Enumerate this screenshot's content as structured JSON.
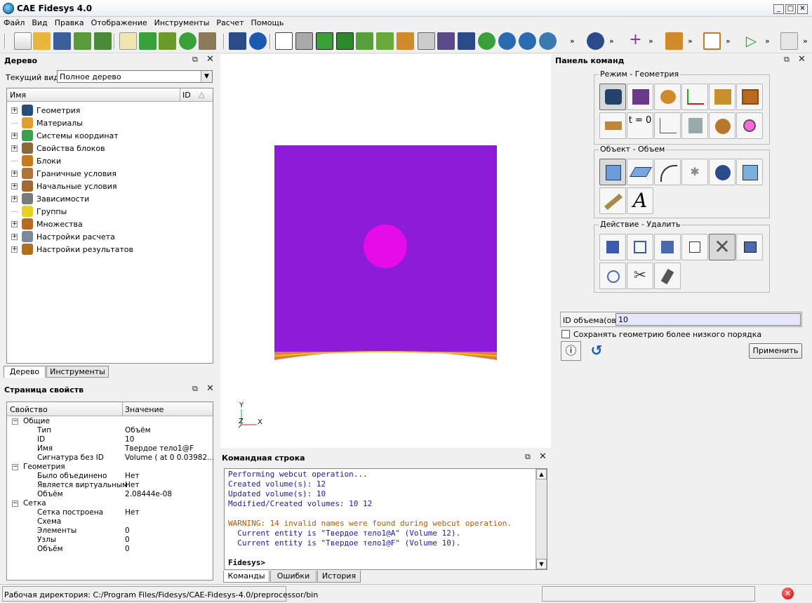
{
  "window": {
    "title": "CAE Fidesys 4.0",
    "minimize": "_",
    "maximize": "□",
    "close": "✕"
  },
  "menu": [
    "Файл",
    "Вид",
    "Правка",
    "Отображение",
    "Инструменты",
    "Расчет",
    "Помощь"
  ],
  "tree_panel": {
    "title": "Дерево",
    "current_view_label": "Текущий вид",
    "current_view_value": "Полное дерево",
    "col_name": "Имя",
    "col_id": "ID",
    "items": [
      {
        "label": "Геометрия",
        "expandable": true,
        "icon": "geometry-icon",
        "color": "#264e7a"
      },
      {
        "label": "Материалы",
        "expandable": false,
        "icon": "materials-icon",
        "color": "#e0a030"
      },
      {
        "label": "Системы координат",
        "expandable": true,
        "icon": "axes-icon",
        "color": "#3aa04a"
      },
      {
        "label": "Свойства блоков",
        "expandable": true,
        "icon": "beam-icon",
        "color": "#8a6a3a"
      },
      {
        "label": "Блоки",
        "expandable": false,
        "icon": "blocks-icon",
        "color": "#c87a1a"
      },
      {
        "label": "Граничные условия",
        "expandable": true,
        "icon": "boundary-icon",
        "color": "#b0743a"
      },
      {
        "label": "Начальные условия",
        "expandable": true,
        "icon": "initial-icon",
        "color": "#a06a30"
      },
      {
        "label": "Зависимости",
        "expandable": true,
        "icon": "graph-icon",
        "color": "#7a7a7a"
      },
      {
        "label": "Группы",
        "expandable": false,
        "icon": "groups-icon",
        "color": "#e8d020"
      },
      {
        "label": "Множества",
        "expandable": true,
        "icon": "sets-icon",
        "color": "#b86a20"
      },
      {
        "label": "Настройки расчета",
        "expandable": true,
        "icon": "calc-icon",
        "color": "#7a8a9a"
      },
      {
        "label": "Настройки результатов",
        "expandable": true,
        "icon": "results-icon",
        "color": "#b07020"
      }
    ],
    "tabs": [
      "Дерево",
      "Инструменты"
    ]
  },
  "props_panel": {
    "title": "Страница свойств",
    "col_prop": "Свойство",
    "col_value": "Значение",
    "rows": [
      {
        "k": "Общие",
        "v": "",
        "level": 0
      },
      {
        "k": "Тип",
        "v": "Объём",
        "level": 1
      },
      {
        "k": "ID",
        "v": "10",
        "level": 1
      },
      {
        "k": "Имя",
        "v": "Твердое тело1@F",
        "level": 1
      },
      {
        "k": "Сигнатура без ID",
        "v": "Volume ( at 0 0.03982...",
        "level": 1
      },
      {
        "k": "Геометрия",
        "v": "",
        "level": 0
      },
      {
        "k": "Было объединено",
        "v": "Нет",
        "level": 1
      },
      {
        "k": "Является виртуальным",
        "v": "Нет",
        "level": 1
      },
      {
        "k": "Объём",
        "v": "2.08444e-08",
        "level": 1
      },
      {
        "k": "Сетка",
        "v": "",
        "level": 0
      },
      {
        "k": "Сетка построена",
        "v": "Нет",
        "level": 1
      },
      {
        "k": "Схема",
        "v": "",
        "level": 1
      },
      {
        "k": "Элементы",
        "v": "0",
        "level": 1
      },
      {
        "k": "Узлы",
        "v": "0",
        "level": 1
      },
      {
        "k": "Объём",
        "v": "0",
        "level": 1
      }
    ]
  },
  "viewport": {
    "axis_y": "Y",
    "axis_z": "Z",
    "axis_x": "X",
    "body_color": "#8e1bd9",
    "hole_color": "#e60ce8",
    "base_color": "#e07c3c"
  },
  "console": {
    "title": "Командная строка",
    "lines": [
      {
        "t": "Performing webcut operation...",
        "c": "#1a1aa6"
      },
      {
        "t": "Created volume(s): 12",
        "c": "#1a1aa6"
      },
      {
        "t": "Updated volume(s): 10",
        "c": "#1a1aa6"
      },
      {
        "t": "Modified/Created volumes: 10 12",
        "c": "#1a1aa6"
      },
      {
        "t": "",
        "c": "#1a1aa6"
      },
      {
        "t": "WARNING: 14 invalid names were found during webcut operation.",
        "c": "#b05a00"
      },
      {
        "t": "  Current entity is \"Твердое тело1@A\" (Volume 12).",
        "c": "#1a1aa6"
      },
      {
        "t": "  Current entity is \"Твердое тело1@F\" (Volume 10).",
        "c": "#1a1aa6"
      }
    ],
    "prompt": "Fidesys>",
    "tabs": [
      "Команды",
      "Ошибки",
      "История"
    ]
  },
  "cmd_panel": {
    "title": "Панель команд",
    "mode_group": "Режим - Геометрия",
    "object_group": "Объект - Объем",
    "action_group": "Действие - Удалить",
    "volume_id_label": "ID объема(ов)",
    "volume_id_value": "10",
    "keep_lower_order_label": "Сохранять геометрию более низкого порядка",
    "apply_button": "Применить",
    "t0_label": "t = 0"
  },
  "status": {
    "working_dir": "Рабочая директория: C:/Program Files/Fidesys/CAE-Fidesys-4.0/preprocessor/bin"
  }
}
